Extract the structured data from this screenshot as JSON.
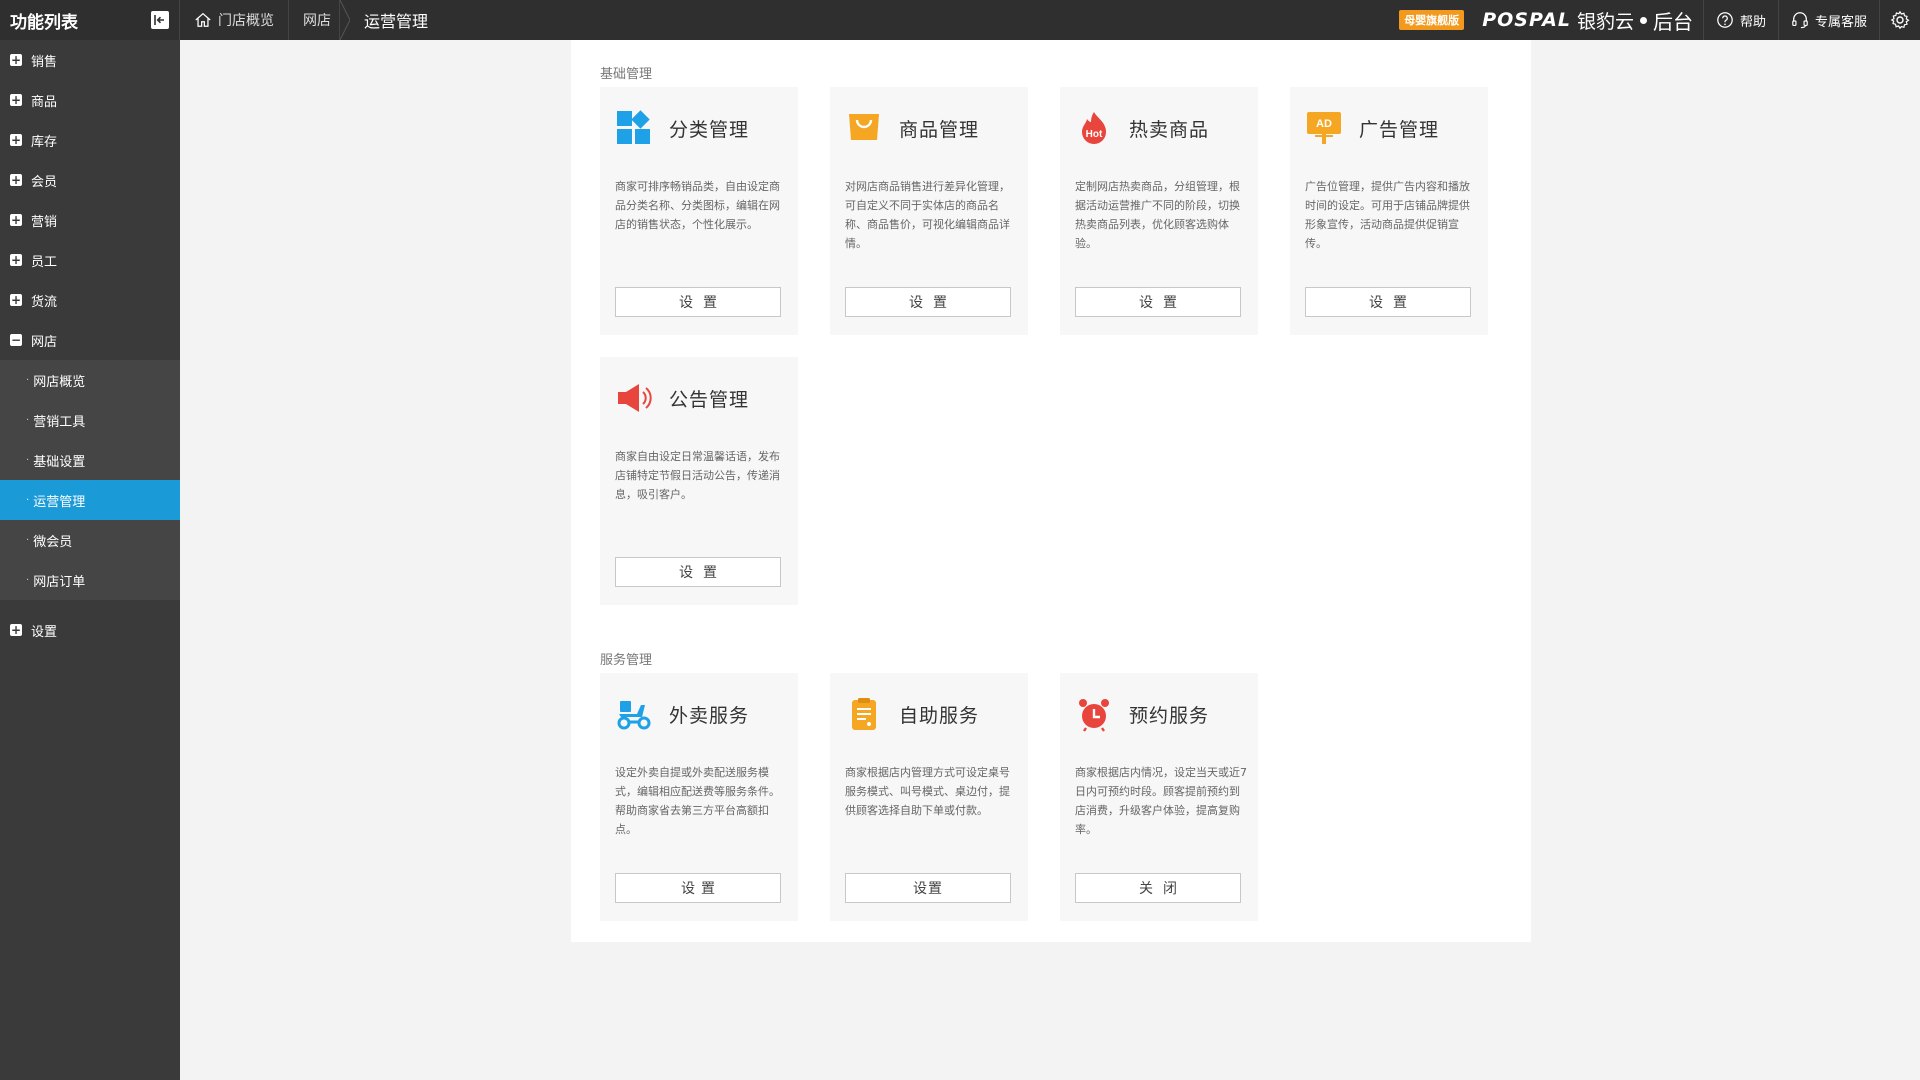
{
  "app": {
    "title": "功能列表"
  },
  "breadcrumb": {
    "home": "门店概览",
    "level1": "网店",
    "current": "运营管理"
  },
  "header": {
    "badge": "母婴旗舰版",
    "brand_en": "POSPAL",
    "brand_cn": "银豹云",
    "brand_suffix": "后台",
    "help": "帮助",
    "service": "专属客服"
  },
  "sidebar": {
    "items": [
      {
        "label": "销售",
        "icon": "plus-icon"
      },
      {
        "label": "商品",
        "icon": "plus-icon"
      },
      {
        "label": "库存",
        "icon": "plus-icon"
      },
      {
        "label": "会员",
        "icon": "plus-icon"
      },
      {
        "label": "营销",
        "icon": "plus-icon"
      },
      {
        "label": "员工",
        "icon": "plus-icon"
      },
      {
        "label": "货流",
        "icon": "plus-icon"
      },
      {
        "label": "网店",
        "icon": "minus-icon"
      }
    ],
    "subitems": [
      {
        "label": "网店概览"
      },
      {
        "label": "营销工具"
      },
      {
        "label": "基础设置"
      },
      {
        "label": "运营管理"
      },
      {
        "label": "微会员"
      },
      {
        "label": "网店订单"
      }
    ],
    "settings": {
      "label": "设置",
      "icon": "plus-icon"
    }
  },
  "sections": {
    "basic": {
      "title": "基础管理",
      "cards": [
        {
          "title": "分类管理",
          "icon": "category-tiles-icon",
          "desc": "商家可排序畅销品类，自由设定商品分类名称、分类图标，编辑在网店的销售状态，个性化展示。",
          "button": "设置"
        },
        {
          "title": "商品管理",
          "icon": "shopping-bag-icon",
          "desc": "对网店商品销售进行差异化管理，可自定义不同于实体店的商品名称、商品售价，可视化编辑商品详情。",
          "button": "设置"
        },
        {
          "title": "热卖商品",
          "icon": "hot-fire-icon",
          "desc": "定制网店热卖商品，分组管理，根据活动运营推广不同的阶段，切换热卖商品列表，优化顾客选购体验。",
          "button": "设置"
        },
        {
          "title": "广告管理",
          "icon": "ad-board-icon",
          "desc": "广告位管理，提供广告内容和播放时间的设定。可用于店铺品牌提供形象宣传，活动商品提供促销宣传。",
          "button": "设置"
        },
        {
          "title": "公告管理",
          "icon": "megaphone-icon",
          "desc": "商家自由设定日常温馨话语，发布店铺特定节假日活动公告，传递消息，吸引客户。",
          "button": "设置"
        }
      ]
    },
    "service": {
      "title": "服务管理",
      "cards": [
        {
          "title": "外卖服务",
          "icon": "scooter-icon",
          "desc": "设定外卖自提或外卖配送服务模式，编辑相应配送费等服务条件。帮助商家省去第三方平台高额扣点。",
          "button": "设置"
        },
        {
          "title": "自助服务",
          "icon": "clipboard-icon",
          "desc": "商家根据店内管理方式可设定桌号服务模式、叫号模式、桌边付，提供顾客选择自助下单或付款。",
          "button": "设置"
        },
        {
          "title": "预约服务",
          "icon": "alarm-clock-icon",
          "desc": "商家根据店内情况，设定当天或近7日内可预约时段。顾客提前预约到店消费，升级客户体验，提高复购率。",
          "button": "关闭"
        }
      ]
    }
  },
  "colors": {
    "topbar": "#2f2f2f",
    "sidebar": "#3a3a3a",
    "sidebar_active": "#1a9ad6",
    "badge": "#f39a1e",
    "icon_blue": "#1ea1e6",
    "icon_orange": "#f5a623",
    "icon_red": "#e8453c"
  }
}
